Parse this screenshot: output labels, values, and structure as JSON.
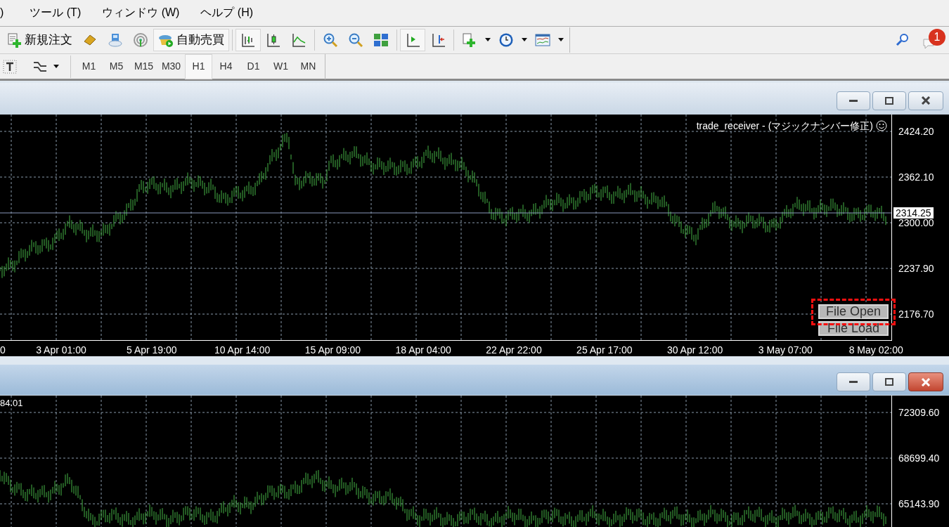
{
  "menu": [
    {
      "label": ")"
    },
    {
      "label": "ツール (T)"
    },
    {
      "label": "ウィンドウ (W)"
    },
    {
      "label": "ヘルプ (H)"
    }
  ],
  "toolbar": [
    {
      "kind": "new-order",
      "label": "新規注文",
      "selected": false
    },
    {
      "kind": "gold",
      "selected": false
    },
    {
      "kind": "server",
      "selected": false
    },
    {
      "kind": "signal",
      "selected": false
    },
    {
      "kind": "auto-trade",
      "label": "自動売買",
      "selected": true
    },
    {
      "kind": "sep"
    },
    {
      "kind": "bars",
      "selected": true
    },
    {
      "kind": "candles",
      "selected": false
    },
    {
      "kind": "line",
      "selected": false
    },
    {
      "kind": "sep"
    },
    {
      "kind": "zoom-in",
      "selected": false
    },
    {
      "kind": "zoom-out",
      "selected": false
    },
    {
      "kind": "tile",
      "selected": false
    },
    {
      "kind": "sep"
    },
    {
      "kind": "autoscroll",
      "selected": true
    },
    {
      "kind": "shift",
      "selected": false
    },
    {
      "kind": "sep"
    },
    {
      "kind": "indicator",
      "selected": false,
      "dropdown": true
    },
    {
      "kind": "clock",
      "selected": false,
      "dropdown": true
    },
    {
      "kind": "template",
      "selected": false,
      "dropdown": true
    }
  ],
  "notifications": {
    "badge": "1"
  },
  "timeframes": [
    {
      "label": "M1",
      "selected": false
    },
    {
      "label": "M5",
      "selected": false
    },
    {
      "label": "M15",
      "selected": false
    },
    {
      "label": "M30",
      "selected": false
    },
    {
      "label": "H1",
      "selected": true
    },
    {
      "label": "H4",
      "selected": false
    },
    {
      "label": "D1",
      "selected": false
    },
    {
      "label": "W1",
      "selected": false
    },
    {
      "label": "MN",
      "selected": false
    }
  ],
  "charts": [
    {
      "active": false,
      "expert": "trade_receiver - (マジックナンバー修正)",
      "prices": [
        "2424.20",
        "2362.10",
        "2300.00",
        "2237.90",
        "2176.70"
      ],
      "current_price": "2314.25",
      "times": [
        "0",
        "3 Apr 01:00",
        "5 Apr 19:00",
        "10 Apr 14:00",
        "15 Apr 09:00",
        "18 Apr 04:00",
        "22 Apr 22:00",
        "25 Apr 17:00",
        "30 Apr 12:00",
        "3 May 07:00",
        "8 May 02:00"
      ],
      "buttons": [
        {
          "label": "File Open"
        },
        {
          "label": "File Load"
        }
      ],
      "highlight": true
    },
    {
      "active": true,
      "corner_label": "84.01",
      "prices": [
        "72309.60",
        "68699.40",
        "65143.90"
      ],
      "highlight": false
    }
  ]
}
